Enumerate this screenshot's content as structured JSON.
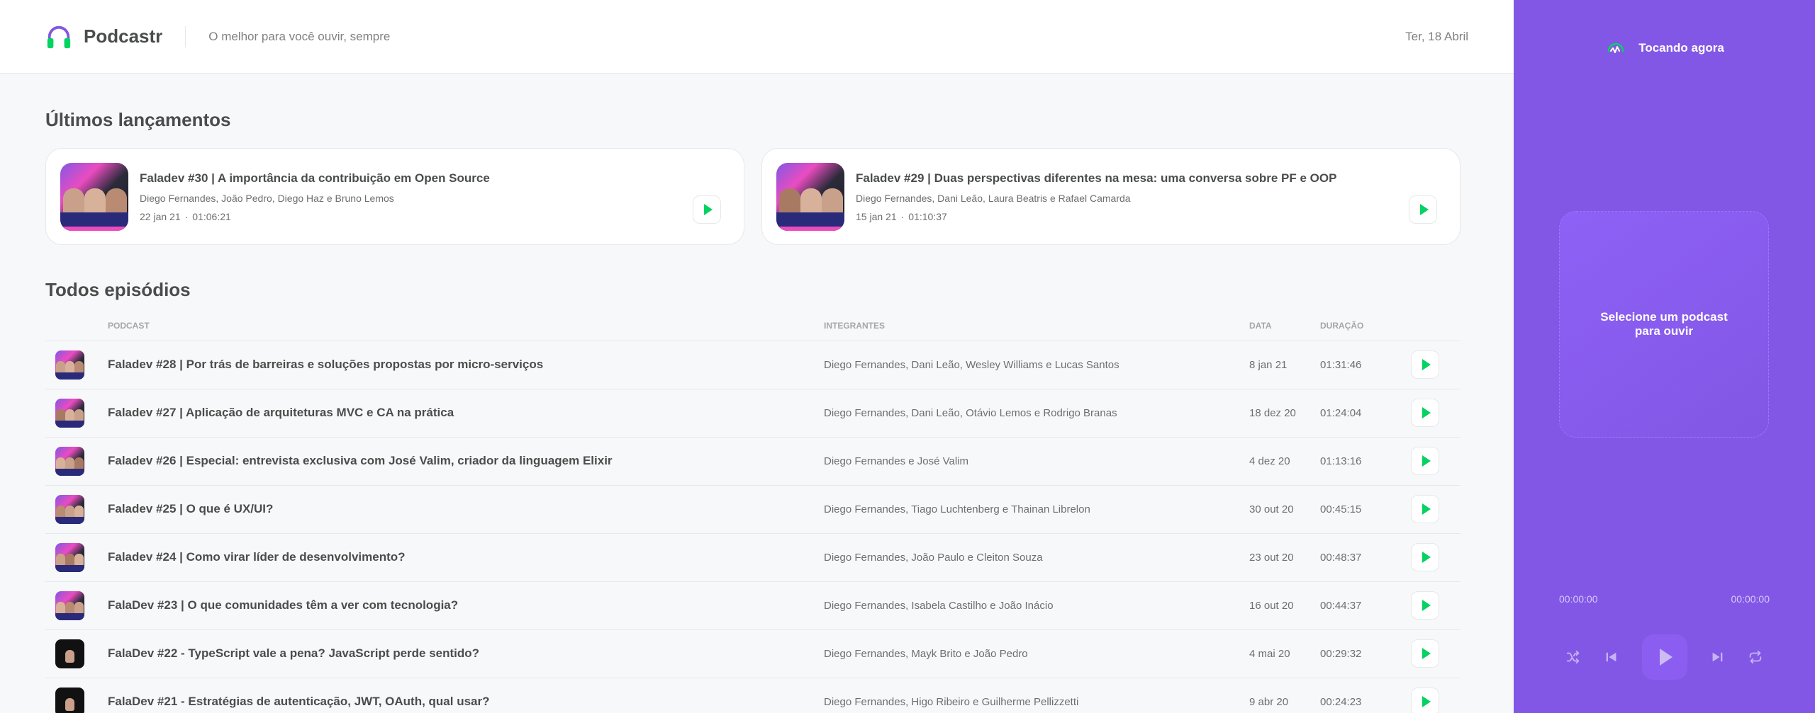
{
  "header": {
    "logo_icon": "headphones-icon",
    "app_name": "Podcastr",
    "tagline": "O melhor para você ouvir, sempre",
    "date": "Ter, 18 Abril"
  },
  "latest": {
    "title": "Últimos lançamentos",
    "items": [
      {
        "title": "Faladev #30 | A importância da contribuição em Open Source",
        "members": "Diego Fernandes, João Pedro, Diego Haz e Bruno Lemos",
        "date": "22 jan 21",
        "separator": "·",
        "duration": "01:06:21"
      },
      {
        "title": "Faladev #29 | Duas perspectivas diferentes na mesa: uma conversa sobre PF e OOP",
        "members": "Diego Fernandes, Dani Leão, Laura Beatris e Rafael Camarda",
        "date": "15 jan 21",
        "separator": "·",
        "duration": "01:10:37"
      }
    ]
  },
  "all": {
    "title": "Todos episódios",
    "columns": [
      "",
      "Podcast",
      "Integrantes",
      "Data",
      "Duração",
      ""
    ],
    "rows": [
      {
        "title": "Faladev #28 | Por trás de barreiras e soluções propostas por micro-serviços",
        "members": "Diego Fernandes, Dani Leão, Wesley Williams e Lucas Santos",
        "date": "8 jan 21",
        "duration": "01:31:46"
      },
      {
        "title": "Faladev #27 | Aplicação de arquiteturas MVC e CA na prática",
        "members": "Diego Fernandes, Dani Leão, Otávio Lemos e Rodrigo Branas",
        "date": "18 dez 20",
        "duration": "01:24:04"
      },
      {
        "title": "Faladev #26 | Especial: entrevista exclusiva com José Valim, criador da linguagem Elixir",
        "members": "Diego Fernandes e José Valim",
        "date": "4 dez 20",
        "duration": "01:13:16"
      },
      {
        "title": "Faladev #25 | O que é UX/UI?",
        "members": "Diego Fernandes, Tiago Luchtenberg e Thainan Librelon",
        "date": "30 out 20",
        "duration": "00:45:15"
      },
      {
        "title": "Faladev #24 | Como virar líder de desenvolvimento?",
        "members": "Diego Fernandes, João Paulo e Cleiton Souza",
        "date": "23 out 20",
        "duration": "00:48:37"
      },
      {
        "title": "FalaDev #23 | O que comunidades têm a ver com tecnologia?",
        "members": "Diego Fernandes, Isabela Castilho e João Inácio",
        "date": "16 out 20",
        "duration": "00:44:37"
      },
      {
        "title": "FalaDev #22 - TypeScript vale a pena? JavaScript perde sentido?",
        "members": "Diego Fernandes, Mayk Brito e João Pedro",
        "date": "4 mai 20",
        "duration": "00:29:32"
      },
      {
        "title": "FalaDev #21 - Estratégias de autenticação, JWT, OAuth, qual usar?",
        "members": "Diego Fernandes, Higo Ribeiro e Guilherme Pellizzetti",
        "date": "9 abr 20",
        "duration": "00:24:23"
      }
    ]
  },
  "player": {
    "header": "Tocando agora",
    "header_icon": "now-playing-icon",
    "empty_text": "Selecione um podcast para ouvir",
    "current_time": "00:00:00",
    "total_time": "00:00:00",
    "progress": 0,
    "controls": [
      "shuffle-icon",
      "previous-icon",
      "play-icon",
      "next-icon",
      "repeat-icon"
    ]
  },
  "colors": {
    "accent": "#8257e5",
    "play_green": "#04d361",
    "background": "#f7f8fa"
  }
}
